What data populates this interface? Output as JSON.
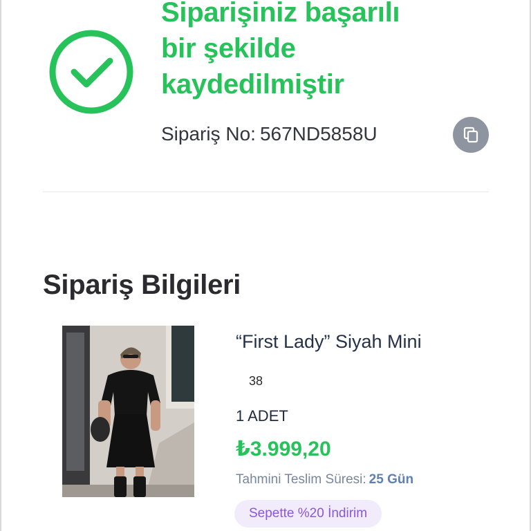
{
  "success": {
    "title_lines": [
      "Siparişiniz başarılı",
      "bir şekilde",
      "kaydedilmiştir"
    ],
    "order_no_label": "Sipariş No:",
    "order_no": "567ND5858U",
    "icon": "check-circle-icon",
    "copy_icon": "copy-icon"
  },
  "order_info": {
    "title": "Sipariş Bilgileri",
    "product": {
      "name": "“First Lady” Siyah Mini",
      "size": "38",
      "quantity": "1 ADET",
      "price": "₺3.999,20",
      "delivery_label": "Tahmini Teslim Süresi:",
      "delivery_days": "25 Gün",
      "discount_badge": "Sepette %20 İndirim"
    }
  },
  "colors": {
    "success_green": "#27c35a",
    "copy_button": "#8e95a0",
    "badge_bg": "#f1ebfc",
    "badge_text": "#8a58d8"
  }
}
